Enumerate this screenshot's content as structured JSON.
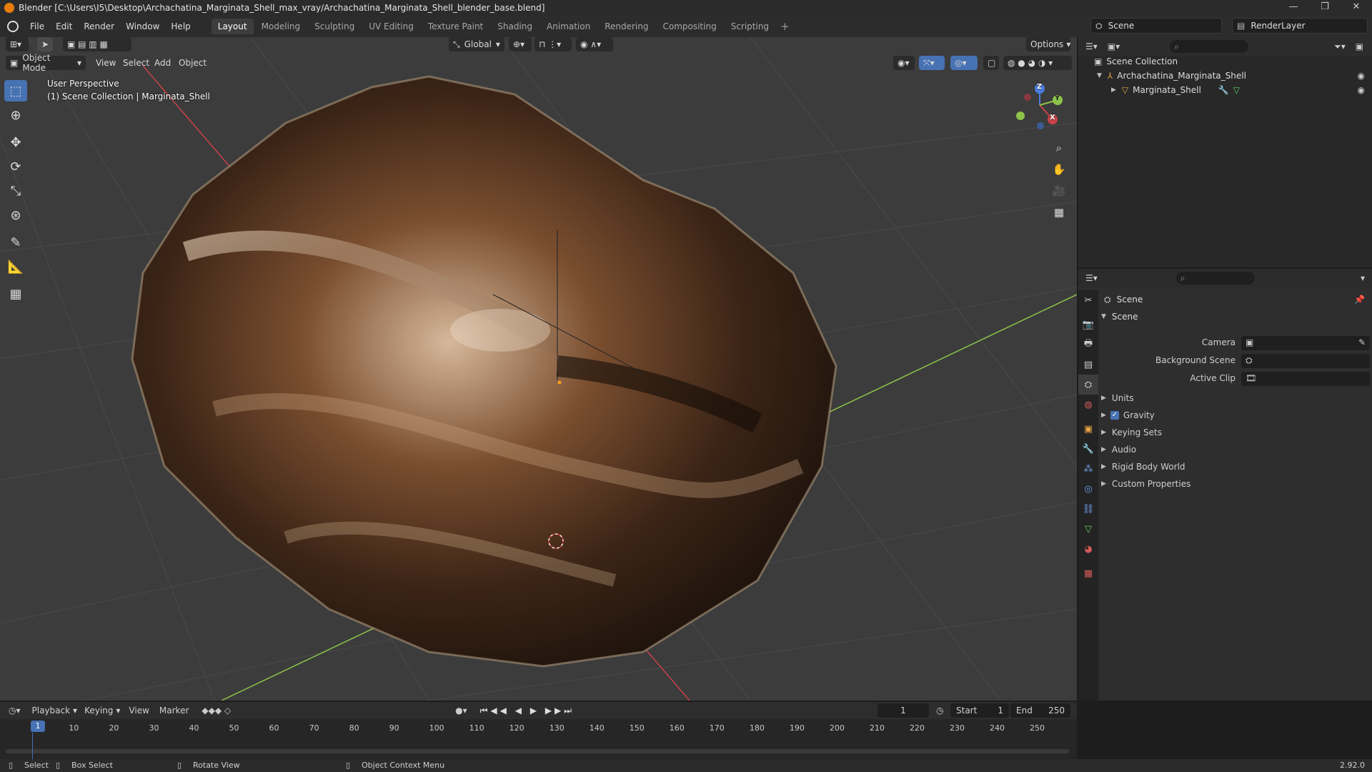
{
  "window": {
    "title": "Blender [C:\\Users\\I5\\Desktop\\Archachatina_Marginata_Shell_max_vray/Archachatina_Marginata_Shell_blender_base.blend]",
    "controls": [
      "—",
      "❐",
      "✕"
    ]
  },
  "menu": {
    "items": [
      "File",
      "Edit",
      "Render",
      "Window",
      "Help"
    ],
    "workspaces": [
      "Layout",
      "Modeling",
      "Sculpting",
      "UV Editing",
      "Texture Paint",
      "Shading",
      "Animation",
      "Rendering",
      "Compositing",
      "Scripting"
    ],
    "active_workspace": "Layout",
    "add_tab": "+",
    "scene": "Scene",
    "render_layer": "RenderLayer"
  },
  "viewport": {
    "mode": "Object Mode",
    "menus": [
      "View",
      "Select",
      "Add",
      "Object"
    ],
    "transform_orientation": "Global",
    "options": "Options",
    "overlay_line1": "User Perspective",
    "overlay_line2": "(1) Scene Collection | Marginata_Shell",
    "gizmo_axes": [
      "X",
      "Y",
      "Z"
    ]
  },
  "tools": [
    "select-box",
    "cursor",
    "move",
    "rotate",
    "scale",
    "transform",
    "annotate",
    "measure",
    "add-cube"
  ],
  "outliner": {
    "root": "Scene Collection",
    "rows": [
      {
        "label": "Archachatina_Marginata_Shell"
      },
      {
        "label": "Marginata_Shell"
      }
    ]
  },
  "properties": {
    "header": "Scene",
    "section": "Scene",
    "fields": [
      {
        "label": "Camera",
        "value": ""
      },
      {
        "label": "Background Scene",
        "value": ""
      },
      {
        "label": "Active Clip",
        "value": ""
      }
    ],
    "subpanels": [
      "Units",
      "Gravity",
      "Keying Sets",
      "Audio",
      "Rigid Body World",
      "Custom Properties"
    ],
    "gravity_checked": true
  },
  "timeline": {
    "menus": [
      "Playback",
      "Keying",
      "View",
      "Marker"
    ],
    "current_frame": "1",
    "start_label": "Start",
    "start": "1",
    "end_label": "End",
    "end": "250",
    "ticks": [
      "1",
      "10",
      "20",
      "30",
      "40",
      "50",
      "60",
      "70",
      "80",
      "90",
      "100",
      "110",
      "120",
      "130",
      "140",
      "150",
      "160",
      "170",
      "180",
      "190",
      "200",
      "210",
      "220",
      "230",
      "240",
      "250"
    ],
    "cursor_label": "1"
  },
  "status": {
    "items": [
      "Select",
      "Box Select",
      "Rotate View",
      "Object Context Menu"
    ],
    "version": "2.92.0"
  },
  "colors": {
    "accent": "#4772b3",
    "x_axis": "#c9434a",
    "y_axis": "#8cc34a",
    "z_axis": "#4a7de0",
    "brand": "#e87d0d"
  }
}
